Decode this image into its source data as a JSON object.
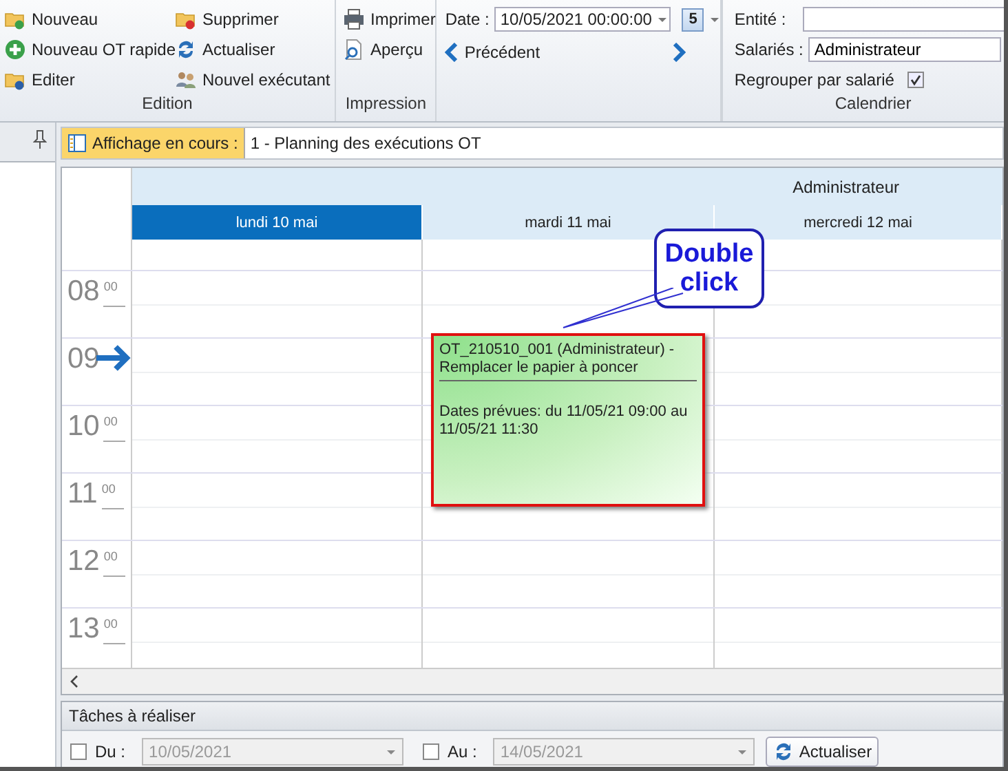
{
  "ribbon": {
    "groups": [
      {
        "label": "Edition",
        "items": [
          {
            "label": "Nouveau"
          },
          {
            "label": "Nouveau OT rapide"
          },
          {
            "label": "Editer"
          },
          {
            "label": "Supprimer"
          },
          {
            "label": "Actualiser"
          },
          {
            "label": "Nouvel exécutant"
          }
        ]
      },
      {
        "label": "Impression",
        "items": [
          {
            "label": "Imprimer"
          },
          {
            "label": "Aperçu"
          }
        ]
      }
    ],
    "date": {
      "label": "Date :",
      "value": "10/05/2021 00:00:00",
      "calendar_day": "5",
      "previous": "Précédent"
    },
    "calendrier": {
      "label": "Calendrier",
      "entity_label": "Entité :",
      "employees_label": "Salariés :",
      "employees_value": "Administrateur",
      "group_label": "Regrouper par salarié",
      "group_checked": true
    }
  },
  "view": {
    "label": "Affichage en cours :",
    "value": "1 - Planning des exécutions OT"
  },
  "calendar": {
    "resource": "Administrateur",
    "days": [
      {
        "label": "lundi 10 mai",
        "selected": true
      },
      {
        "label": "mardi 11 mai",
        "selected": false
      },
      {
        "label": "mercredi 12 mai",
        "selected": false
      }
    ],
    "hours": [
      {
        "hour": "08",
        "minutes": "00",
        "current": false
      },
      {
        "hour": "09",
        "current": true
      },
      {
        "hour": "10",
        "minutes": "00",
        "current": false
      },
      {
        "hour": "11",
        "minutes": "00",
        "current": false
      },
      {
        "hour": "12",
        "minutes": "00",
        "current": false
      },
      {
        "hour": "13",
        "minutes": "00",
        "current": false
      }
    ],
    "event": {
      "title": "OT_210510_001 (Administrateur) - Remplacer le papier à poncer",
      "details": "Dates prévues: du 11/05/21 09:00 au 11/05/21 11:30",
      "selected": true
    },
    "callout": "Double click"
  },
  "tasks": {
    "title": "Tâches à réaliser",
    "from": {
      "label": "Du :",
      "checked": false,
      "value": "10/05/2021"
    },
    "to": {
      "label": "Au :",
      "checked": false,
      "value": "14/05/2021"
    },
    "button": "Actualiser"
  }
}
